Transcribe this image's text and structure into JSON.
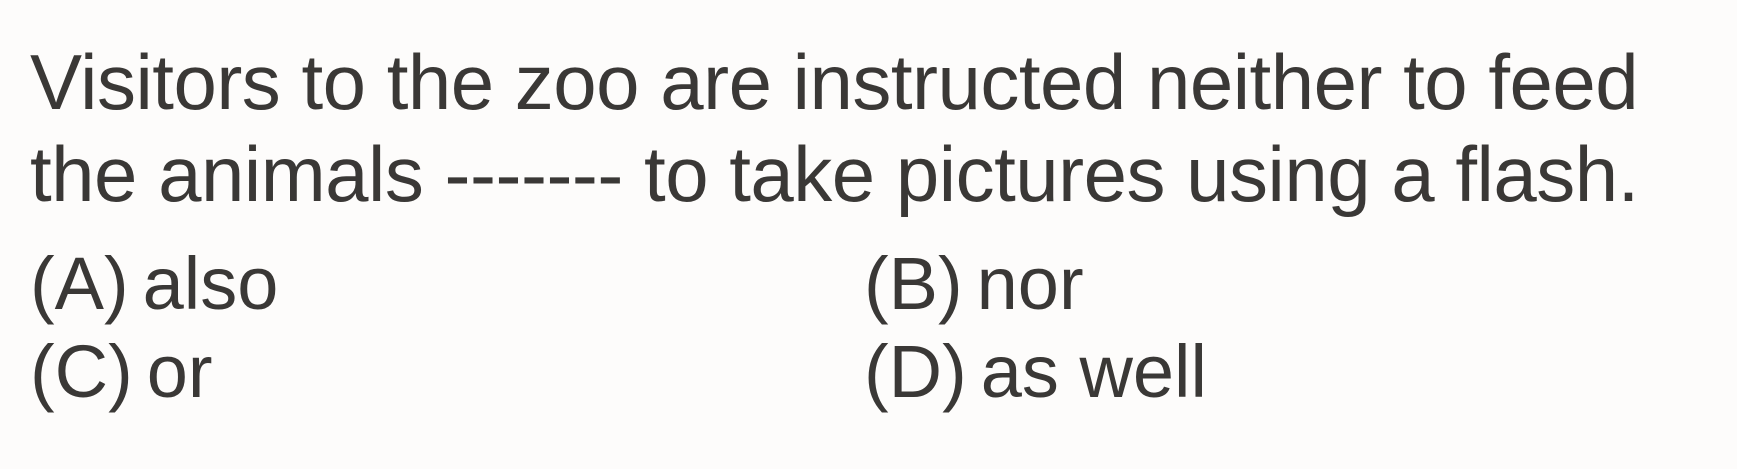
{
  "question": {
    "line1": "Visitors to the zoo are instructed neither to feed",
    "line2": "the animals ------- to take pictures using a flash."
  },
  "options": [
    {
      "letter": "(A)",
      "text": "also"
    },
    {
      "letter": "(B)",
      "text": "nor"
    },
    {
      "letter": "(C)",
      "text": "or"
    },
    {
      "letter": "(D)",
      "text": "as well"
    }
  ]
}
